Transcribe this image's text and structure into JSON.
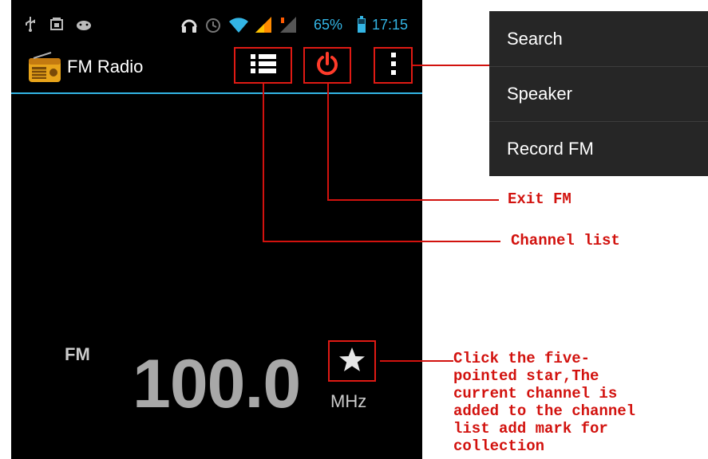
{
  "status_bar": {
    "battery_text": "65%",
    "time": "17:15",
    "left_icons": [
      "usb-icon",
      "sim-card-icon",
      "android-icon"
    ],
    "right_icons": [
      "headphones-icon",
      "alarm-icon",
      "wifi-icon",
      "signal-icon",
      "signal-icon",
      "battery-icon"
    ],
    "accent_color": "#33b5e5"
  },
  "action_bar": {
    "title": "FM Radio",
    "app_icon": "radio-icon",
    "buttons": [
      "channel-list-icon",
      "power-icon",
      "overflow-menu-icon"
    ]
  },
  "player": {
    "band": "FM",
    "frequency": "100.0",
    "unit": "MHz",
    "favorite_icon": "star-icon"
  },
  "overflow_menu": {
    "items": [
      {
        "label": "Search"
      },
      {
        "label": "Speaker"
      },
      {
        "label": "Record FM"
      }
    ]
  },
  "annotations": {
    "exit": "Exit FM",
    "channel_list": "Channel list",
    "star": "Click the five-\npointed star,The\ncurrent channel is\nadded to the channel\nlist add mark for\ncollection",
    "color": "#d2120e"
  }
}
